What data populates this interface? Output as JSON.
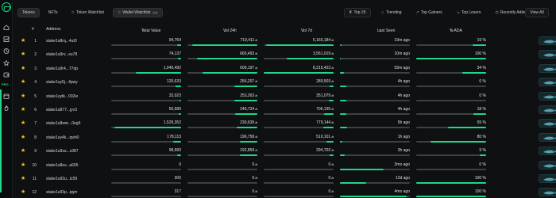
{
  "tabs": [
    {
      "label": "Tokens",
      "active": true
    },
    {
      "label": "NFTs",
      "active": false
    },
    {
      "label": "Token Watchlist",
      "active": false
    },
    {
      "label": "Wallet Watchlist",
      "active": true,
      "badge": "beta"
    }
  ],
  "filters": [
    {
      "label": "Top 25",
      "icon": "trophy-icon"
    },
    {
      "label": "Trending",
      "icon": "flame-icon"
    },
    {
      "label": "Top Gainers",
      "icon": "trend-up-icon"
    },
    {
      "label": "Top Losers",
      "icon": "trend-down-icon"
    },
    {
      "label": "Recently Added",
      "icon": "clock-icon"
    }
  ],
  "view_all": "View All",
  "rail": {
    "pro_label": "PRO"
  },
  "columns": {
    "num": "#",
    "address": "Address",
    "total_value": "Total Value",
    "vol24h": "Vol 24h",
    "vol7d": "Vol 7d",
    "last_seen": "Last Seen",
    "pct_ada": "% ADA"
  },
  "colors": {
    "accent": "#1fd68b",
    "star": "#f2c21b",
    "background": "#0e1011"
  },
  "rows": [
    {
      "starred": true,
      "num": "1",
      "address": "stake1u8rq...4ut0",
      "total_value": "94,764",
      "total_fill": 0.06,
      "vol24h": "719,411",
      "vol24h_fill": 0.93,
      "vol7d": "5,165,184",
      "vol7d_fill": 0.97,
      "last_seen": "19m ago",
      "last_fill": 0.02,
      "pct_ada": "19 %",
      "pct_fill": 0.19
    },
    {
      "starred": true,
      "num": "2",
      "address": "stake1u9rv...xu78",
      "total_value": "74,137",
      "total_fill": 0.05,
      "vol24h": "665,493",
      "vol24h_fill": 0.86,
      "vol7d": "3,561,019",
      "vol7d_fill": 0.67,
      "last_seen": "10m ago",
      "last_fill": 0.01,
      "pct_ada": "100 %",
      "pct_fill": 1.0
    },
    {
      "starred": true,
      "num": "3",
      "address": "stake1u9r4...77dp",
      "total_value": "1,040,492",
      "total_fill": 0.65,
      "vol24h": "606,197",
      "vol24h_fill": 0.78,
      "vol7d": "8,215,423",
      "vol7d_fill": 1.0,
      "last_seen": "59m ago",
      "last_fill": 0.06,
      "pct_ada": "34 %",
      "pct_fill": 0.34
    },
    {
      "starred": true,
      "num": "4",
      "address": "stake1uy5j...4pwy",
      "total_value": "120,633",
      "total_fill": 0.08,
      "vol24h": "256,207",
      "vol24h_fill": 0.33,
      "vol7d": "289,503",
      "vol7d_fill": 0.06,
      "last_seen": "4h ago",
      "last_fill": 0.09,
      "pct_ada": "0 %",
      "pct_fill": 0.0
    },
    {
      "starred": true,
      "num": "5",
      "address": "stake1uytk...002w",
      "total_value": "32,023",
      "total_fill": 0.02,
      "vol24h": "253,263",
      "vol24h_fill": 0.33,
      "vol7d": "351,079",
      "vol7d_fill": 0.07,
      "last_seen": "4h ago",
      "last_fill": 0.09,
      "pct_ada": "0 %",
      "pct_fill": 0.0
    },
    {
      "starred": true,
      "num": "6",
      "address": "stake1u877...jyv3",
      "total_value": "50,589",
      "total_fill": 0.03,
      "vol24h": "246,734",
      "vol24h_fill": 0.32,
      "vol7d": "706,195",
      "vol7d_fill": 0.14,
      "last_seen": "4h ago",
      "last_fill": 0.09,
      "pct_ada": "18 %",
      "pct_fill": 0.18
    },
    {
      "starred": true,
      "num": "7",
      "address": "stake1u8wm...0eg5",
      "total_value": "1,529,352",
      "total_fill": 0.95,
      "vol24h": "230,639",
      "vol24h_fill": 0.3,
      "vol7d": "779,144",
      "vol7d_fill": 0.15,
      "last_seen": "5h ago",
      "last_fill": 0.1,
      "pct_ada": "55 %",
      "pct_fill": 0.55
    },
    {
      "starred": true,
      "num": "8",
      "address": "stake1uy4k...qwh0",
      "total_value": "178,113",
      "total_fill": 0.11,
      "vol24h": "196,758",
      "vol24h_fill": 0.25,
      "vol7d": "510,101",
      "vol7d_fill": 0.1,
      "last_seen": "1h ago",
      "last_fill": 0.03,
      "pct_ada": "80 %",
      "pct_fill": 0.8
    },
    {
      "starred": true,
      "num": "9",
      "address": "stake1u9su...s387",
      "total_value": "98,660",
      "total_fill": 0.06,
      "vol24h": "192,859",
      "vol24h_fill": 0.25,
      "vol7d": "294,702",
      "vol7d_fill": 0.06,
      "last_seen": "3h ago",
      "last_fill": 0.07,
      "pct_ada": "9 %",
      "pct_fill": 0.09
    },
    {
      "starred": true,
      "num": "10",
      "address": "stake1u8ev...a605",
      "total_value": "0",
      "total_fill": 0.0,
      "vol24h": "0",
      "vol24h_fill": 0.0,
      "vol7d": "0",
      "vol7d_fill": 0.0,
      "last_seen": "3mo ago",
      "last_fill": 0.63,
      "pct_ada": "0 %",
      "pct_fill": 0.0
    },
    {
      "starred": true,
      "num": "11",
      "address": "stake1u93u...lz59",
      "total_value": "300",
      "total_fill": 0.0,
      "vol24h": "0",
      "vol24h_fill": 0.0,
      "vol7d": "0",
      "vol7d_fill": 0.0,
      "last_seen": "12d ago",
      "last_fill": 0.38,
      "pct_ada": "100 %",
      "pct_fill": 1.0
    },
    {
      "starred": true,
      "num": "12",
      "address": "stake1u93p...tpjm",
      "total_value": "317",
      "total_fill": 0.0,
      "vol24h": "0",
      "vol24h_fill": 0.0,
      "vol7d": "0",
      "vol7d_fill": 0.0,
      "last_seen": "4mo ago",
      "last_fill": 0.95,
      "pct_ada": "100 %",
      "pct_fill": 1.0
    }
  ]
}
